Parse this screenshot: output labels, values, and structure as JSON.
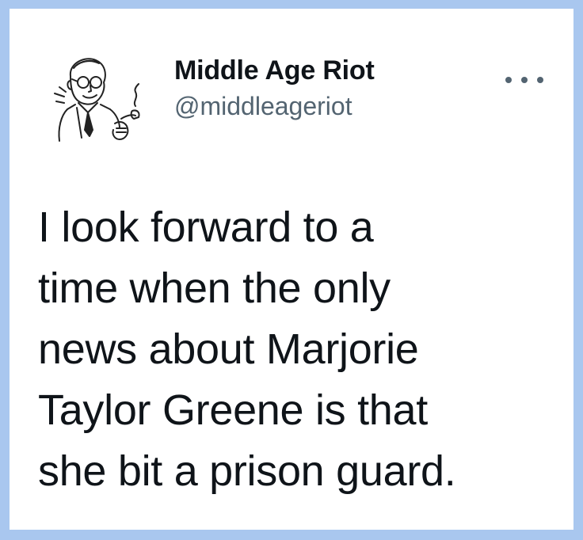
{
  "tweet": {
    "author": {
      "display_name": "Middle Age Riot",
      "handle": "@middleageriot",
      "avatar_icon": "vintage-pipe-smoking-man-illustration"
    },
    "more_icon": "more-options-icon",
    "text_lines": [
      "I look forward to a",
      "time when the only",
      "news about Marjorie",
      "Taylor Greene is that",
      "she bit a prison guard."
    ]
  },
  "colors": {
    "border": "#a9c7ef",
    "card": "#ffffff",
    "text": "#0f1419",
    "secondary": "#536471"
  }
}
